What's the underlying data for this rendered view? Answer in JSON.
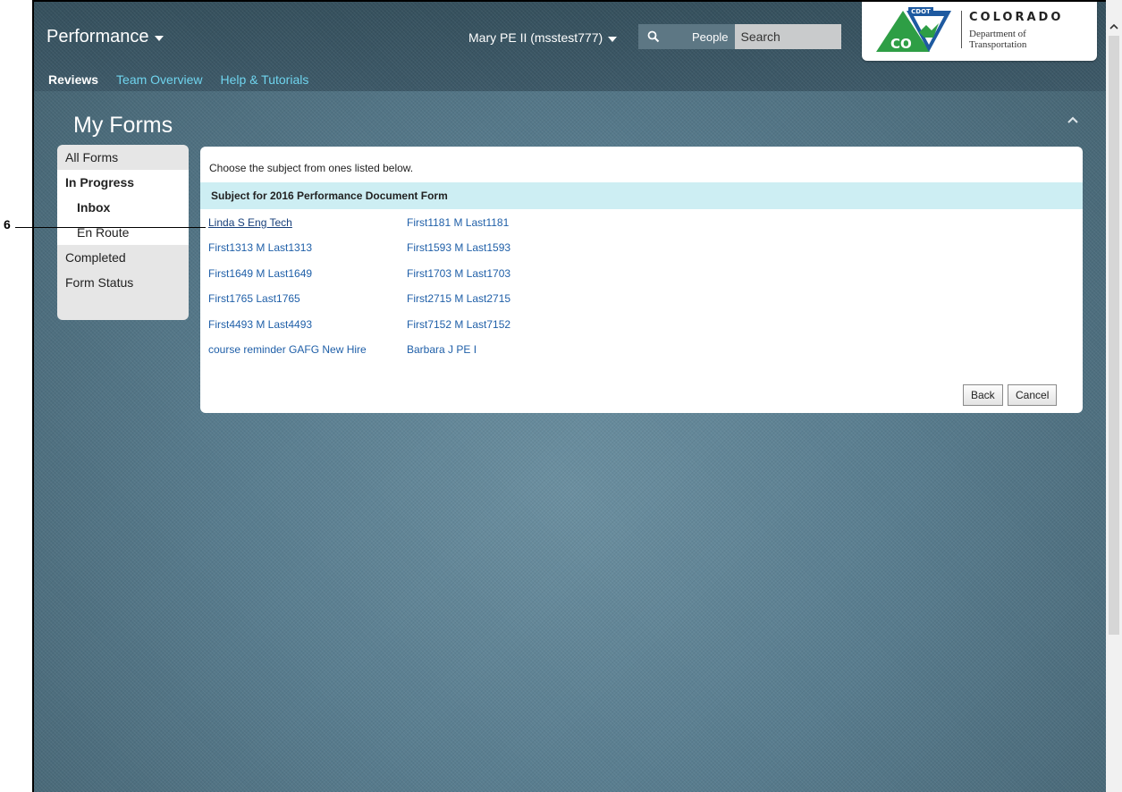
{
  "header": {
    "app_title": "Performance",
    "user": "Mary PE II (msstest777)",
    "search_scope": "People",
    "search_placeholder": "Search",
    "logo": {
      "badge": "CDOT",
      "mark": "CO",
      "wordmark": "COLORADO",
      "subtitle_line1": "Department of",
      "subtitle_line2": "Transportation"
    }
  },
  "nav": {
    "items": [
      {
        "label": "Reviews"
      },
      {
        "label": "Team Overview"
      },
      {
        "label": "Help & Tutorials"
      }
    ]
  },
  "main": {
    "title": "My Forms"
  },
  "side_menu": {
    "items": [
      {
        "label": "All Forms"
      },
      {
        "label": "In Progress"
      },
      {
        "label": "Inbox"
      },
      {
        "label": "En Route"
      },
      {
        "label": "Completed"
      },
      {
        "label": "Form Status"
      }
    ]
  },
  "card": {
    "instruction": "Choose the subject from ones listed below.",
    "heading": "Subject for 2016 Performance Document Form",
    "subjects": [
      "Linda S Eng Tech",
      "First1181 M Last1181",
      "First1313 M Last1313",
      "First1593 M Last1593",
      "First1649 M Last1649",
      "First1703 M Last1703",
      "First1765 Last1765",
      "First2715 M Last2715",
      "First4493 M Last4493",
      "First7152 M Last7152",
      "course reminder GAFG New Hire",
      "Barbara J PE I"
    ],
    "back_label": "Back",
    "cancel_label": "Cancel"
  },
  "callout": {
    "number": "6"
  },
  "colors": {
    "link": "#1f5fa8",
    "nav_link": "#6fd4ee",
    "subject_header_bg": "#cdeef3",
    "app_bg": "#587c8e"
  },
  "icons": {
    "search": "search-icon",
    "caret": "caret-down-icon",
    "collapse": "chevron-up-icon",
    "scroll_up": "scroll-up-icon"
  }
}
